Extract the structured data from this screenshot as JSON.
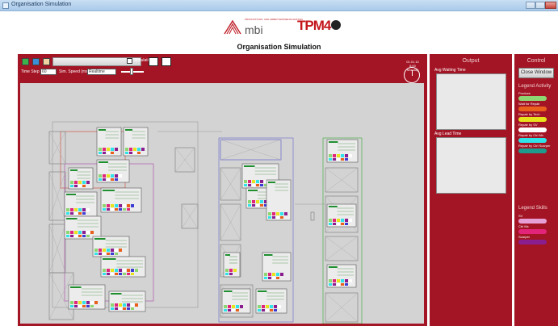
{
  "window": {
    "title": "Organisation Simulation"
  },
  "logos": {
    "mbi_text": "mbi",
    "mbi_subtitle": "PRODUKTIONS- UND ARBEITSWISSENSCHAFTEN",
    "tpm_text": "TPM4"
  },
  "page_title": "Organisation Simulation",
  "toolbar": {
    "checkbox_label": "Simulation",
    "time_step_label": "Time Step",
    "time_step_value": "60",
    "sim_speed_label": "Sim. Speed (ms)",
    "sim_speed_value": "Realtime",
    "clock_line1": "01.01.10 8:00",
    "clock_line2": "Monday"
  },
  "output": {
    "title": "Output",
    "box1_label": "Avg Waiting Time",
    "box2_label": "Avg Lead Time"
  },
  "control": {
    "title": "Control",
    "close_button": "Close Window",
    "legend_activity_title": "Legend Activity",
    "activities": [
      {
        "label": "Produce",
        "color": "#8ed672"
      },
      {
        "label": "Wait for Repair",
        "color": "#e8601c"
      },
      {
        "label": "Repair by Tech",
        "color": "#e8e21c"
      },
      {
        "label": "Repair by SV",
        "color": "#ffffff"
      },
      {
        "label": "Repair by Ctrl Mx",
        "color": "#2fe3e8"
      },
      {
        "label": "Repair by Ctrl Scarper",
        "color": "#1f9a8e"
      }
    ],
    "legend_skills_title": "Legend Skills",
    "skills": [
      {
        "label": "SV",
        "color": "#e7a0d6"
      },
      {
        "label": "Ctrl Mx",
        "color": "#e2257a"
      },
      {
        "label": "Scarper",
        "color": "#8a1e8f"
      }
    ]
  }
}
